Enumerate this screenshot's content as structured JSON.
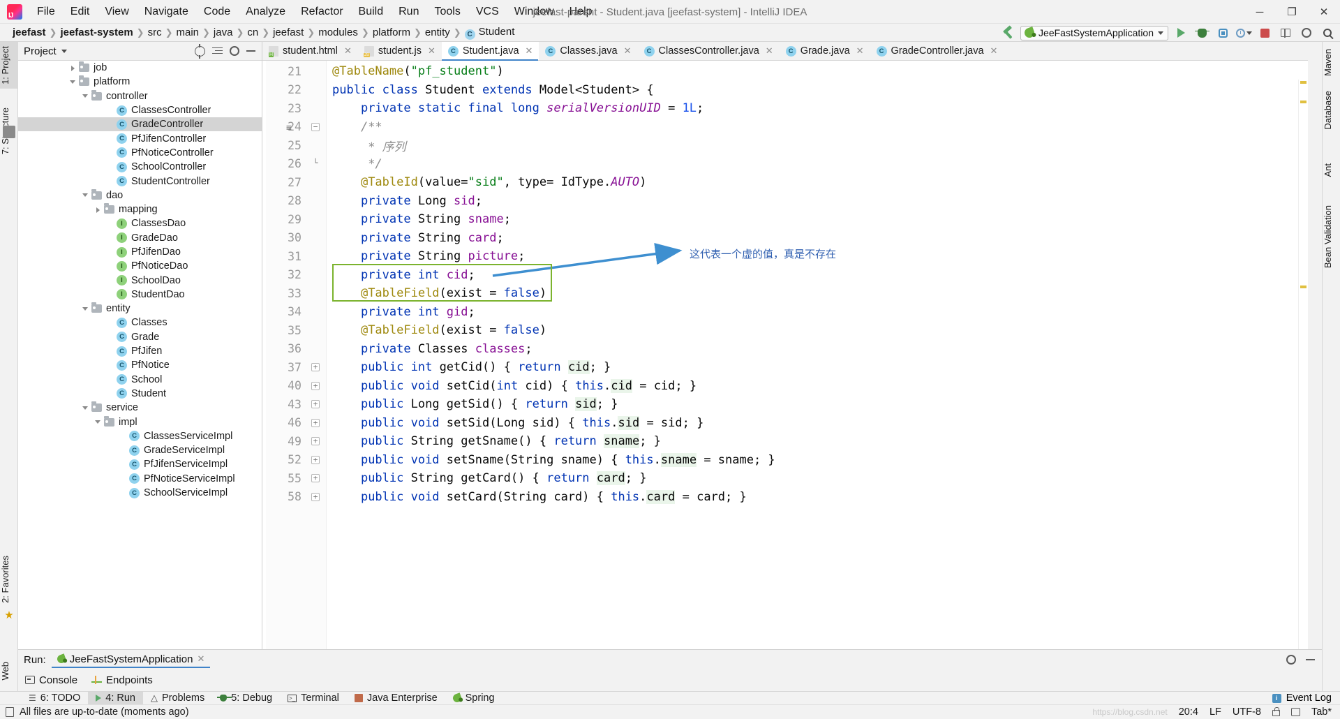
{
  "window": {
    "title": "jeefast-parent - Student.java [jeefast-system] - IntelliJ IDEA",
    "logo_name": "intellij-idea-logo",
    "minimize": "─",
    "maximize": "❐",
    "close": "✕"
  },
  "menubar": [
    {
      "label": "File"
    },
    {
      "label": "Edit"
    },
    {
      "label": "View"
    },
    {
      "label": "Navigate"
    },
    {
      "label": "Code"
    },
    {
      "label": "Analyze"
    },
    {
      "label": "Refactor"
    },
    {
      "label": "Build"
    },
    {
      "label": "Run"
    },
    {
      "label": "Tools"
    },
    {
      "label": "VCS"
    },
    {
      "label": "Window"
    },
    {
      "label": "Help"
    }
  ],
  "breadcrumbs": [
    {
      "label": "jeefast",
      "bold": true
    },
    {
      "label": "jeefast-system",
      "bold": true
    },
    {
      "label": "src",
      "bold": false
    },
    {
      "label": "main",
      "bold": false
    },
    {
      "label": "java",
      "bold": false
    },
    {
      "label": "cn",
      "bold": false
    },
    {
      "label": "jeefast",
      "bold": false
    },
    {
      "label": "modules",
      "bold": false
    },
    {
      "label": "platform",
      "bold": false
    },
    {
      "label": "entity",
      "bold": false
    },
    {
      "label": "Student",
      "bold": false,
      "icon": "C"
    }
  ],
  "toolbar": {
    "build_icon": "hammer-build-icon",
    "run_config": "JeeFastSystemApplication",
    "run_icon": "run-icon",
    "debug_icon": "debug-icon",
    "coverage_icon": "run-with-coverage-icon",
    "profiler_icon": "profiler-icon",
    "stop_icon": "stop-icon",
    "layout_icon": "layout-icon",
    "settings_icon": "settings-icon",
    "search_icon": "search-everywhere-icon"
  },
  "left_strip": [
    {
      "label": "1: Project",
      "active": true
    },
    {
      "label": "7: Structure",
      "active": false
    },
    {
      "label": "2: Favorites",
      "active": false
    },
    {
      "label": "Web",
      "active": false
    }
  ],
  "right_strip": [
    {
      "label": "Maven"
    },
    {
      "label": "Database"
    },
    {
      "label": "Ant"
    },
    {
      "label": "Bean Validation"
    }
  ],
  "project_panel": {
    "title": "Project",
    "scope_caret": "▼",
    "locate_icon": "locate-file-icon",
    "collapse_icon": "collapse-all-icon",
    "settings_icon": "gear-icon",
    "hide_icon": "hide-icon",
    "tree": [
      {
        "label": "job",
        "indent": 4,
        "twist": "r",
        "icon": "folder",
        "sel": false
      },
      {
        "label": "platform",
        "indent": 4,
        "twist": "d",
        "icon": "folder",
        "sel": false
      },
      {
        "label": "controller",
        "indent": 5,
        "twist": "d",
        "icon": "folder",
        "sel": false
      },
      {
        "label": "ClassesController",
        "indent": 7,
        "twist": "",
        "icon": "class",
        "sel": false
      },
      {
        "label": "GradeController",
        "indent": 7,
        "twist": "",
        "icon": "class",
        "sel": true
      },
      {
        "label": "PfJifenController",
        "indent": 7,
        "twist": "",
        "icon": "class",
        "sel": false
      },
      {
        "label": "PfNoticeController",
        "indent": 7,
        "twist": "",
        "icon": "class",
        "sel": false
      },
      {
        "label": "SchoolController",
        "indent": 7,
        "twist": "",
        "icon": "class",
        "sel": false
      },
      {
        "label": "StudentController",
        "indent": 7,
        "twist": "",
        "icon": "class",
        "sel": false
      },
      {
        "label": "dao",
        "indent": 5,
        "twist": "d",
        "icon": "folder",
        "sel": false
      },
      {
        "label": "mapping",
        "indent": 6,
        "twist": "r",
        "icon": "folder",
        "sel": false
      },
      {
        "label": "ClassesDao",
        "indent": 7,
        "twist": "",
        "icon": "interface",
        "sel": false
      },
      {
        "label": "GradeDao",
        "indent": 7,
        "twist": "",
        "icon": "interface",
        "sel": false
      },
      {
        "label": "PfJifenDao",
        "indent": 7,
        "twist": "",
        "icon": "interface",
        "sel": false
      },
      {
        "label": "PfNoticeDao",
        "indent": 7,
        "twist": "",
        "icon": "interface",
        "sel": false
      },
      {
        "label": "SchoolDao",
        "indent": 7,
        "twist": "",
        "icon": "interface",
        "sel": false
      },
      {
        "label": "StudentDao",
        "indent": 7,
        "twist": "",
        "icon": "interface",
        "sel": false
      },
      {
        "label": "entity",
        "indent": 5,
        "twist": "d",
        "icon": "folder",
        "sel": false
      },
      {
        "label": "Classes",
        "indent": 7,
        "twist": "",
        "icon": "class",
        "sel": false
      },
      {
        "label": "Grade",
        "indent": 7,
        "twist": "",
        "icon": "class",
        "sel": false
      },
      {
        "label": "PfJifen",
        "indent": 7,
        "twist": "",
        "icon": "class",
        "sel": false
      },
      {
        "label": "PfNotice",
        "indent": 7,
        "twist": "",
        "icon": "class",
        "sel": false
      },
      {
        "label": "School",
        "indent": 7,
        "twist": "",
        "icon": "class",
        "sel": false
      },
      {
        "label": "Student",
        "indent": 7,
        "twist": "",
        "icon": "class",
        "sel": false
      },
      {
        "label": "service",
        "indent": 5,
        "twist": "d",
        "icon": "folder",
        "sel": false
      },
      {
        "label": "impl",
        "indent": 6,
        "twist": "d",
        "icon": "folder",
        "sel": false
      },
      {
        "label": "ClassesServiceImpl",
        "indent": 8,
        "twist": "",
        "icon": "class",
        "sel": false
      },
      {
        "label": "GradeServiceImpl",
        "indent": 8,
        "twist": "",
        "icon": "class",
        "sel": false
      },
      {
        "label": "PfJifenServiceImpl",
        "indent": 8,
        "twist": "",
        "icon": "class",
        "sel": false
      },
      {
        "label": "PfNoticeServiceImpl",
        "indent": 8,
        "twist": "",
        "icon": "class",
        "sel": false
      },
      {
        "label": "SchoolServiceImpl",
        "indent": 8,
        "twist": "",
        "icon": "class",
        "sel": false
      }
    ]
  },
  "editor_tabs": [
    {
      "label": "student.html",
      "icon": "html-file-icon",
      "active": false
    },
    {
      "label": "student.js",
      "icon": "js-file-icon",
      "active": false
    },
    {
      "label": "Student.java",
      "icon": "java-class-icon",
      "active": true
    },
    {
      "label": "Classes.java",
      "icon": "java-class-icon",
      "active": false
    },
    {
      "label": "ClassesController.java",
      "icon": "java-class-icon",
      "active": false
    },
    {
      "label": "Grade.java",
      "icon": "java-class-icon",
      "active": false
    },
    {
      "label": "GradeController.java",
      "icon": "java-class-icon",
      "active": false
    }
  ],
  "code": {
    "lines": [
      {
        "num": "21",
        "fold": "",
        "gutter": "",
        "html": "<span class=\"ann\">@TableName</span>(<span class=\"str\">\"pf_student\"</span>)"
      },
      {
        "num": "22",
        "fold": "",
        "gutter": "",
        "html": "<span class=\"kw\">public class</span> Student <span class=\"kw\">extends</span> Model&lt;Student&gt; {"
      },
      {
        "num": "23",
        "fold": "",
        "gutter": "",
        "html": "    <span class=\"kw\">private static final long</span> <span class=\"stat\">serialVersionUID</span> = <span class=\"num\">1L</span>;"
      },
      {
        "num": "24",
        "fold": "minus",
        "gutter": "doc",
        "html": "    <span class=\"cmt\">/**</span>"
      },
      {
        "num": "25",
        "fold": "",
        "gutter": "",
        "html": "     <span class=\"cmt\">* 序列</span>"
      },
      {
        "num": "26",
        "fold": "end",
        "gutter": "",
        "html": "     <span class=\"cmt\">*/</span>"
      },
      {
        "num": "27",
        "fold": "",
        "gutter": "",
        "html": "    <span class=\"ann\">@TableId</span>(value=<span class=\"str\">\"sid\"</span>, type= IdType.<span class=\"stat\">AUTO</span>)"
      },
      {
        "num": "28",
        "fold": "",
        "gutter": "",
        "html": "    <span class=\"kw\">private</span> Long <span class=\"fld\">sid</span>;"
      },
      {
        "num": "29",
        "fold": "",
        "gutter": "",
        "html": "    <span class=\"kw\">private</span> String <span class=\"fld\">sname</span>;"
      },
      {
        "num": "30",
        "fold": "",
        "gutter": "",
        "html": "    <span class=\"kw\">private</span> String <span class=\"fld\">card</span>;"
      },
      {
        "num": "31",
        "fold": "",
        "gutter": "",
        "html": "    <span class=\"kw\">private</span> String <span class=\"fld\">picture</span>;"
      },
      {
        "num": "32",
        "fold": "",
        "gutter": "",
        "html": "    <span class=\"kw\">private int</span> <span class=\"fld\">cid</span>;"
      },
      {
        "num": "33",
        "fold": "",
        "gutter": "",
        "html": "    <span class=\"ann\">@TableField</span>(exist = <span class=\"kw\">false</span>)"
      },
      {
        "num": "34",
        "fold": "",
        "gutter": "",
        "html": "    <span class=\"kw\">private int</span> <span class=\"fld\">gid</span>;"
      },
      {
        "num": "35",
        "fold": "",
        "gutter": "",
        "html": "    <span class=\"ann\">@TableField</span>(exist = <span class=\"kw\">false</span>)"
      },
      {
        "num": "36",
        "fold": "",
        "gutter": "",
        "html": "    <span class=\"kw\">private</span> Classes <span class=\"fld\">classes</span>;"
      },
      {
        "num": "37",
        "fold": "plus",
        "gutter": "",
        "html": "    <span class=\"kw\">public int</span> <span class=\"mth\">getCid</span>() { <span class=\"kw\">return</span> <span class=\"hl\">cid</span>; }"
      },
      {
        "num": "40",
        "fold": "plus",
        "gutter": "",
        "html": "    <span class=\"kw\">public void</span> <span class=\"mth\">setCid</span>(<span class=\"kw\">int</span> cid) { <span class=\"kw\">this</span>.<span class=\"hl\">cid</span> = cid; }"
      },
      {
        "num": "43",
        "fold": "plus",
        "gutter": "",
        "html": "    <span class=\"kw\">public</span> Long <span class=\"mth\">getSid</span>() { <span class=\"kw\">return</span> <span class=\"hl\">sid</span>; }"
      },
      {
        "num": "46",
        "fold": "plus",
        "gutter": "",
        "html": "    <span class=\"kw\">public void</span> <span class=\"mth\">setSid</span>(Long sid) { <span class=\"kw\">this</span>.<span class=\"hl\">sid</span> = sid; }"
      },
      {
        "num": "49",
        "fold": "plus",
        "gutter": "",
        "html": "    <span class=\"kw\">public</span> String <span class=\"mth\">getSname</span>() { <span class=\"kw\">return</span> <span class=\"hl\">sname</span>; }"
      },
      {
        "num": "52",
        "fold": "plus",
        "gutter": "",
        "html": "    <span class=\"kw\">public void</span> <span class=\"mth\">setSname</span>(String sname) { <span class=\"kw\">this</span>.<span class=\"hl\">sname</span> = sname; }"
      },
      {
        "num": "55",
        "fold": "plus",
        "gutter": "",
        "html": "    <span class=\"kw\">public</span> String <span class=\"mth\">getCard</span>() { <span class=\"kw\">return</span> <span class=\"hl\">card</span>; }"
      },
      {
        "num": "58",
        "fold": "plus",
        "gutter": "",
        "html": "    <span class=\"kw\">public void</span> <span class=\"mth\">setCard</span>(String card) { <span class=\"kw\">this</span>.<span class=\"hl\">card</span> = card; }"
      }
    ]
  },
  "annotation": {
    "text": "这代表一个虚的值，真是不存在",
    "box_color": "#7bb32e",
    "arrow_color": "#3e8fd0",
    "text_color": "#2f5fb0"
  },
  "run_panel": {
    "label": "Run:",
    "config": "JeeFastSystemApplication",
    "close_icon": "close-icon",
    "settings_icon": "gear-icon",
    "hide_icon": "hide-icon",
    "tabs": [
      {
        "label": "Console",
        "icon": "console-icon"
      },
      {
        "label": "Endpoints",
        "icon": "endpoints-icon"
      }
    ]
  },
  "bottom_bar": {
    "items": [
      {
        "label": "6: TODO",
        "icon": "todo-icon",
        "active": false
      },
      {
        "label": "4: Run",
        "icon": "run-icon",
        "active": true
      },
      {
        "label": "Problems",
        "icon": "warning-icon",
        "active": false
      },
      {
        "label": "5: Debug",
        "icon": "debug-icon",
        "active": false
      },
      {
        "label": "Terminal",
        "icon": "terminal-icon",
        "active": false
      },
      {
        "label": "Java Enterprise",
        "icon": "java-ee-icon",
        "active": false
      },
      {
        "label": "Spring",
        "icon": "spring-icon",
        "active": false
      }
    ],
    "event_log": "Event Log",
    "event_icon": "event-log-icon"
  },
  "status_bar": {
    "message": "All files are up-to-date (moments ago)",
    "message_icon": "file-icon",
    "caret": "20:4",
    "line_sep": "LF",
    "encoding": "UTF-8",
    "lock_icon": "lock-icon",
    "branch_icon": "branch-icon",
    "indent": "Tab*",
    "watermark": "https://blog.csdn.net"
  }
}
